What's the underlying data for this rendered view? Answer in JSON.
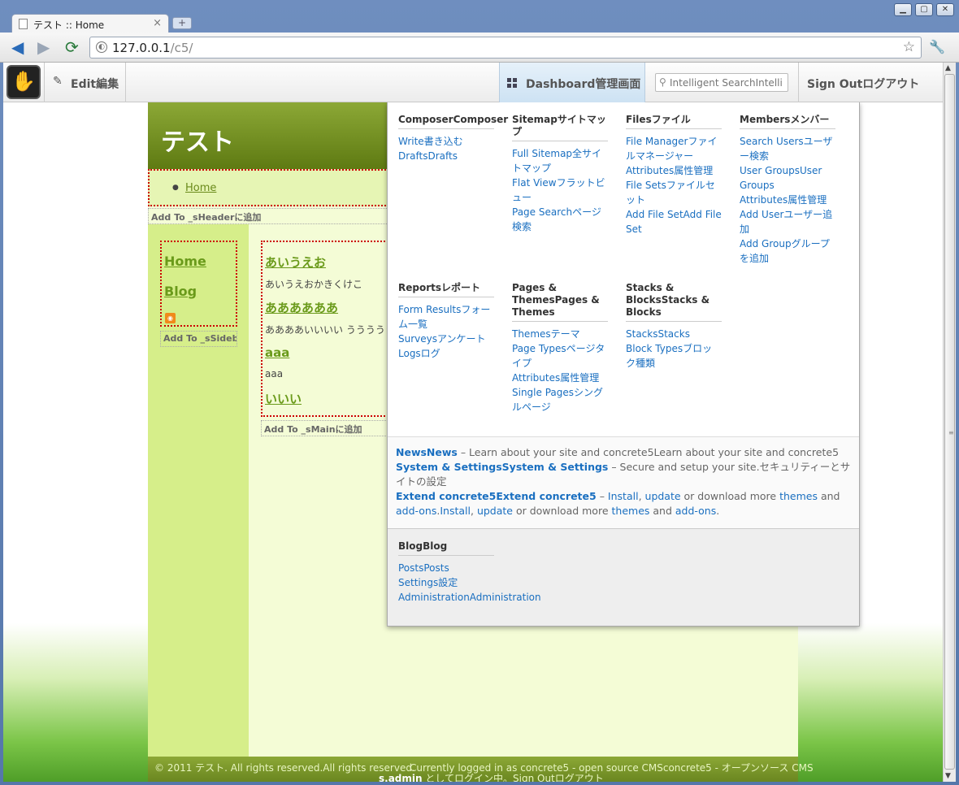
{
  "browser": {
    "tab_title": "テスト :: Home",
    "url_host": "127.0.0.1",
    "url_path": "/c5/"
  },
  "c5bar": {
    "edit": "Edit編集",
    "dashboard": "Dashboard管理画面",
    "search_placeholder": "Intelligent SearchIntelli",
    "signout": "Sign Outログアウト"
  },
  "site": {
    "title": "テスト",
    "nav_home": "Home",
    "add_header": "Add To _sHeaderに追加",
    "side_links": [
      "Home",
      "Blog"
    ],
    "add_side": "Add To _sSidebar",
    "posts": [
      {
        "title": "あいうえお",
        "body": "あいうえおかきくけこ"
      },
      {
        "title": "ああああああ",
        "body": "ああああいいいい ううううう"
      },
      {
        "title": "aaa",
        "body": "aaa"
      },
      {
        "title": "いいい",
        "body": ""
      }
    ],
    "add_main": "Add To _sMainに追加",
    "footer_copy": "© 2011 テスト.   All rights reserved.All rights reserved.",
    "footer_mid": "Currently logged in as  concrete5 - open source CMSconcrete5 - オープンソース CMS",
    "footer_user": "s.admin",
    "footer_tail": " としてログイン中。Sign Outログアウト"
  },
  "dashboard": {
    "columns": [
      {
        "head": "ComposerComposer",
        "items": [
          "Write書き込む",
          "DraftsDrafts"
        ]
      },
      {
        "head": "Sitemapサイトマップ",
        "items": [
          "Full Sitemap全サイトマップ",
          "Flat Viewフラットビュー",
          "Page Searchページ検索"
        ]
      },
      {
        "head": "Filesファイル",
        "items": [
          "File Managerファイルマネージャー",
          "Attributes属性管理",
          "File Setsファイルセット",
          "Add File SetAdd File Set"
        ]
      },
      {
        "head": "Membersメンバー",
        "items": [
          "Search Usersユーザー検索",
          "User GroupsUser Groups",
          "Attributes属性管理",
          "Add Userユーザー追加",
          "Add Groupグループを追加"
        ]
      },
      {
        "head": "Reportsレポート",
        "items": [
          "Form Resultsフォーム一覧",
          "Surveysアンケート",
          "Logsログ"
        ]
      },
      {
        "head": "Pages & ThemesPages & Themes",
        "items": [
          "Themesテーマ",
          "Page Typesページタイプ",
          "Attributes属性管理",
          "Single Pagesシングルページ"
        ]
      },
      {
        "head": "Stacks & BlocksStacks & Blocks",
        "items": [
          "StacksStacks",
          "Block Typesブロック種類"
        ]
      }
    ],
    "news": {
      "news_link": "NewsNews",
      "news_text": " – Learn about your site and concrete5Learn about your site and concrete5",
      "system_link": "System & SettingsSystem & Settings",
      "system_text": " – Secure and setup your site.セキュリティーとサイトの設定",
      "extend_link": "Extend concrete5Extend concrete5",
      "extend_dash": " – ",
      "install": "Install",
      "comma": ", ",
      "update": "update",
      "or_download": " or download more ",
      "themes": "themes",
      "and": " and ",
      "addons": "add-ons",
      "dot": ".",
      "install2": "Install",
      "update2": "update",
      "themes2": "themes",
      "addons2": "add-ons"
    },
    "blog": {
      "head": "BlogBlog",
      "items": [
        "PostsPosts",
        "Settings設定",
        "AdministrationAdministration"
      ]
    }
  }
}
